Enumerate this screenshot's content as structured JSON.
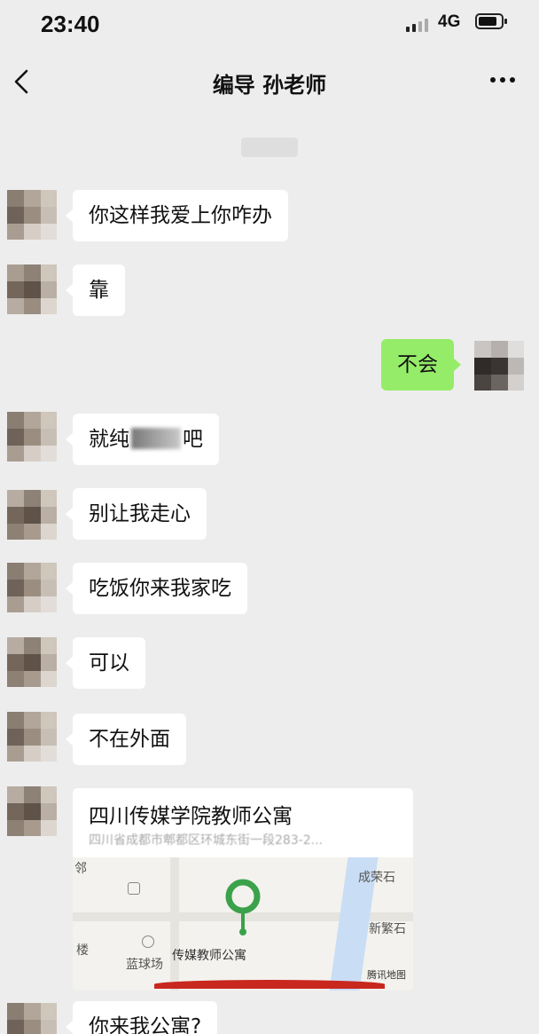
{
  "status_bar": {
    "time": "23:40",
    "network": "4G"
  },
  "nav": {
    "title": "编导 孙老师"
  },
  "messages": [
    {
      "sender": "other",
      "text": "你这样我爱上你咋办"
    },
    {
      "sender": "other",
      "text": "靠"
    },
    {
      "sender": "self",
      "text": "不会"
    },
    {
      "sender": "other",
      "text_before": "就纯",
      "text_after": "吧"
    },
    {
      "sender": "other",
      "text": "别让我走心"
    },
    {
      "sender": "other",
      "text": "吃饭你来我家吃"
    },
    {
      "sender": "other",
      "text": "可以"
    },
    {
      "sender": "other",
      "text": "不在外面"
    },
    {
      "sender": "other",
      "text": "你来我公寓?"
    }
  ],
  "location_card": {
    "title": "四川传媒学院教师公寓",
    "address": "四川省成都市郫都区环城东街一段283-2...",
    "map": {
      "pin_label": "传媒教师公寓",
      "labels": [
        "邻",
        "楼",
        "蓝球场",
        "成荣石",
        "新繁石"
      ],
      "credit": "腾讯地图"
    }
  },
  "colors": {
    "background": "#ededed",
    "bubble_other": "#ffffff",
    "bubble_self": "#95ec69",
    "map_pin": "#3aa24a",
    "highlight_underline": "#c8281e"
  }
}
